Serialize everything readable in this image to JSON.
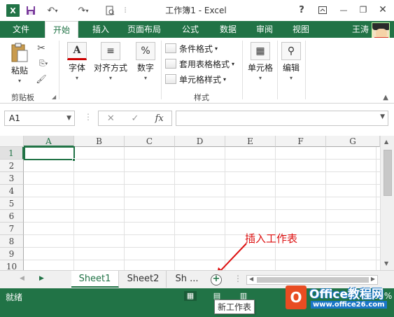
{
  "window": {
    "title": "工作簿1 - Excel",
    "app_logo": "X",
    "help": "?",
    "min": "—",
    "restore": "❐",
    "close": "✕"
  },
  "ribbon_tabs": [
    {
      "label": "文件"
    },
    {
      "label": "开始"
    },
    {
      "label": "插入"
    },
    {
      "label": "页面布局"
    },
    {
      "label": "公式"
    },
    {
      "label": "数据"
    },
    {
      "label": "审阅"
    },
    {
      "label": "视图"
    }
  ],
  "user": {
    "name": "王涛"
  },
  "ribbon": {
    "paste": "粘贴",
    "clipboard_group": "剪贴板",
    "font": "字体",
    "alignment": "对齐方式",
    "number": "数字",
    "conditional_format": "条件格式",
    "table_format": "套用表格格式",
    "cell_styles": "单元格样式",
    "styles_group": "样式",
    "cells": "单元格",
    "editing": "编辑",
    "number_icon": "%",
    "font_icon": "A"
  },
  "formula_bar": {
    "name_box": "A1",
    "cancel": "✕",
    "confirm": "✓",
    "fx": "fx",
    "value": ""
  },
  "grid": {
    "columns": [
      "A",
      "B",
      "C",
      "D",
      "E",
      "F",
      "G"
    ],
    "rows": [
      "1",
      "2",
      "3",
      "4",
      "5",
      "6",
      "7",
      "8",
      "9",
      "10"
    ],
    "selected_cell": "A1"
  },
  "sheets": [
    {
      "name": "Sheet1"
    },
    {
      "name": "Sheet2"
    },
    {
      "name": "Sh ..."
    }
  ],
  "add_sheet_symbol": "+",
  "annotation": "插入工作表",
  "tooltip": "新工作表",
  "status": {
    "ready": "就绪",
    "zoom": "100%"
  },
  "watermark": {
    "logo": "O",
    "title": "Office教程网",
    "url": "www.office26.com"
  },
  "colors": {
    "accent": "#217346",
    "annotation": "#dd1111"
  }
}
